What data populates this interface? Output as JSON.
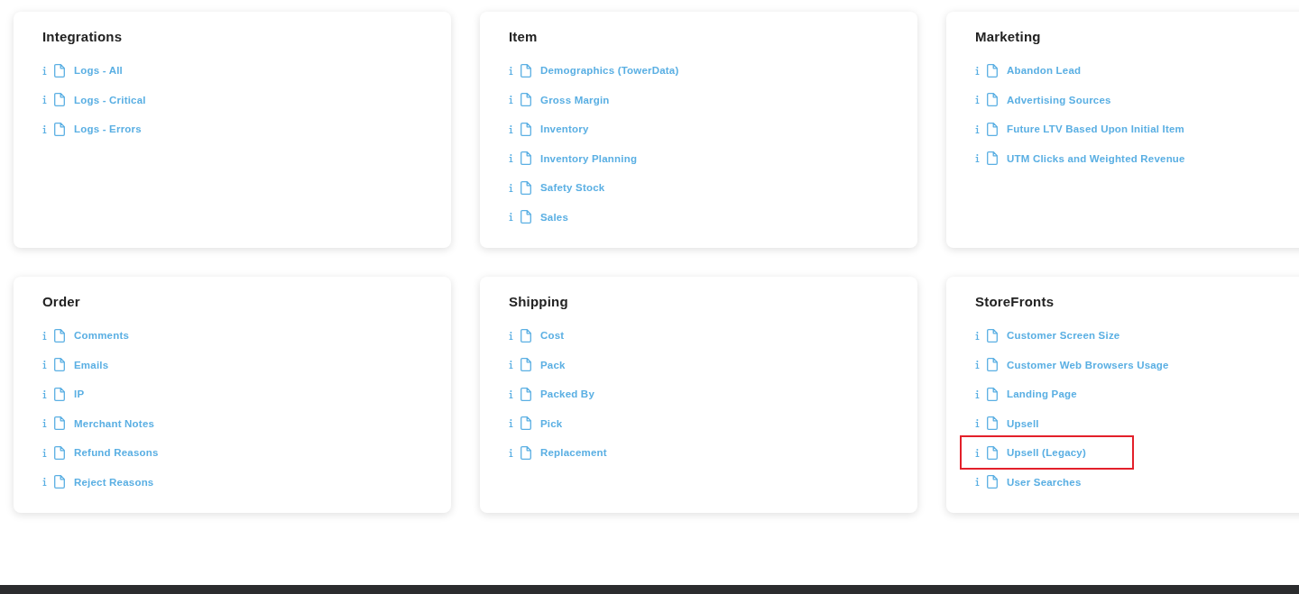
{
  "sections": [
    {
      "title": "Integrations",
      "reports": [
        {
          "label": "Logs - All",
          "highlighted": false
        },
        {
          "label": "Logs - Critical",
          "highlighted": false
        },
        {
          "label": "Logs - Errors",
          "highlighted": false
        }
      ]
    },
    {
      "title": "Item",
      "reports": [
        {
          "label": "Demographics (TowerData)",
          "highlighted": false
        },
        {
          "label": "Gross Margin",
          "highlighted": false
        },
        {
          "label": "Inventory",
          "highlighted": false
        },
        {
          "label": "Inventory Planning",
          "highlighted": false
        },
        {
          "label": "Safety Stock",
          "highlighted": false
        },
        {
          "label": "Sales",
          "highlighted": false
        }
      ]
    },
    {
      "title": "Marketing",
      "reports": [
        {
          "label": "Abandon Lead",
          "highlighted": false
        },
        {
          "label": "Advertising Sources",
          "highlighted": false
        },
        {
          "label": "Future LTV Based Upon Initial Item",
          "highlighted": false
        },
        {
          "label": "UTM Clicks and Weighted Revenue",
          "highlighted": false
        }
      ]
    },
    {
      "title": "Order",
      "reports": [
        {
          "label": "Comments",
          "highlighted": false
        },
        {
          "label": "Emails",
          "highlighted": false
        },
        {
          "label": "IP",
          "highlighted": false
        },
        {
          "label": "Merchant Notes",
          "highlighted": false
        },
        {
          "label": "Refund Reasons",
          "highlighted": false
        },
        {
          "label": "Reject Reasons",
          "highlighted": false
        }
      ]
    },
    {
      "title": "Shipping",
      "reports": [
        {
          "label": "Cost",
          "highlighted": false
        },
        {
          "label": "Pack",
          "highlighted": false
        },
        {
          "label": "Packed By",
          "highlighted": false
        },
        {
          "label": "Pick",
          "highlighted": false
        },
        {
          "label": "Replacement",
          "highlighted": false
        }
      ]
    },
    {
      "title": "StoreFronts",
      "reports": [
        {
          "label": "Customer Screen Size",
          "highlighted": false
        },
        {
          "label": "Customer Web Browsers Usage",
          "highlighted": false
        },
        {
          "label": "Landing Page",
          "highlighted": false
        },
        {
          "label": "Upsell",
          "highlighted": false
        },
        {
          "label": "Upsell (Legacy)",
          "highlighted": true
        },
        {
          "label": "User Searches",
          "highlighted": false
        }
      ]
    }
  ]
}
